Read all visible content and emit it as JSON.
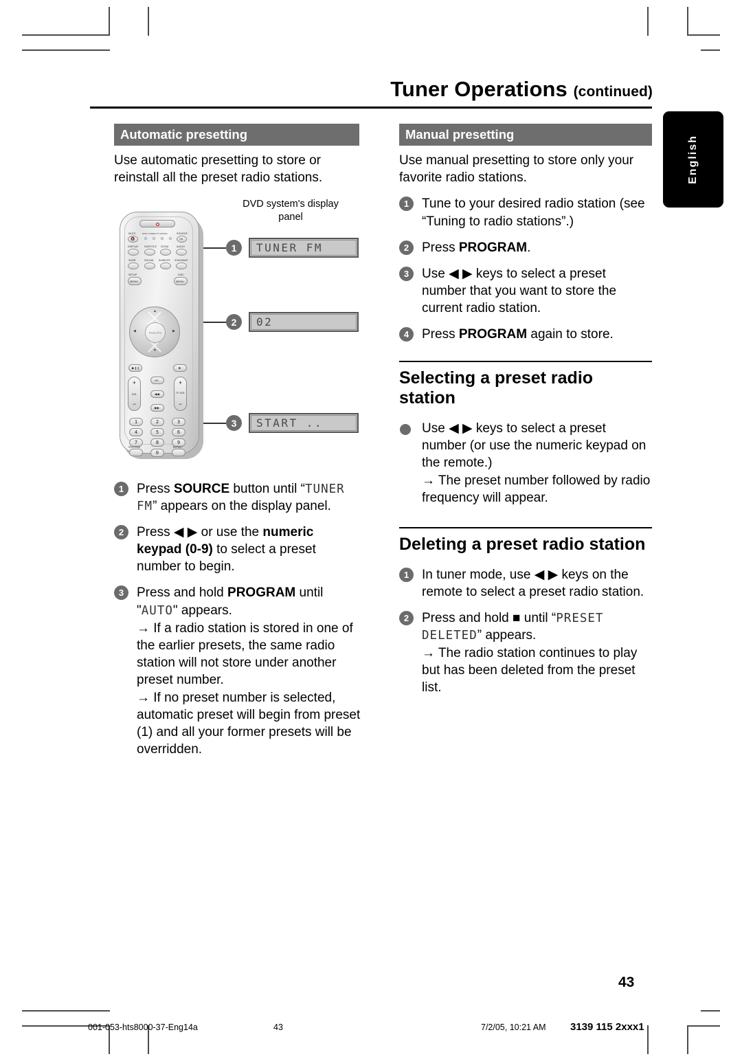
{
  "page": {
    "title": "Tuner Operations",
    "title_suffix": "(continued)",
    "language_tab": "English",
    "page_number": "43"
  },
  "left_column": {
    "section_header": "Automatic presetting",
    "intro": "Use automatic presetting to store or reinstall all the preset radio stations.",
    "illustration": {
      "caption": "DVD system's display panel",
      "remote_brand": "PHILIPS",
      "callouts": [
        {
          "num": "1",
          "display_text": "TUNER FM"
        },
        {
          "num": "2",
          "display_text": "02"
        },
        {
          "num": "3",
          "display_text": "START .."
        }
      ],
      "remote_labels": {
        "mute": "MUTE",
        "source_indicators": "DISC TUNER TV AUX/DI",
        "source": "SOURCE",
        "source_button": "ON",
        "display": "DISPLAY",
        "subtitle": "SUBTITLE",
        "zoom": "ZOOM",
        "audio": "AUDIO",
        "surr": "SURR",
        "sound": "SOUND",
        "surround_off": "SURR/OFF",
        "sonowave": "SONOWAVE",
        "setup": "SETUP",
        "setup_button": "MENU",
        "disc": "DISC",
        "disc_button": "MENU",
        "ok": "OK",
        "vol": "VOL",
        "tv_vol": "TV VOL",
        "program": "PROGRAM",
        "repeat": "REPEAT",
        "keys": [
          "1",
          "2",
          "3",
          "4",
          "5",
          "6",
          "7",
          "8",
          "9",
          "0"
        ]
      }
    },
    "steps": [
      {
        "num": "1",
        "parts": [
          {
            "t": "Press ",
            "s": "n"
          },
          {
            "t": "SOURCE",
            "s": "b"
          },
          {
            "t": " button until “",
            "s": "n"
          },
          {
            "t": "TUNER FM",
            "s": "lcd"
          },
          {
            "t": "” appears on the display panel.",
            "s": "n"
          }
        ]
      },
      {
        "num": "2",
        "parts": [
          {
            "t": "Press ",
            "s": "n"
          },
          {
            "t": "◀ ▶",
            "s": "n"
          },
          {
            "t": " or use the ",
            "s": "n"
          },
          {
            "t": "numeric keypad (0-9)",
            "s": "b"
          },
          {
            "t": " to select a preset number to begin.",
            "s": "n"
          }
        ]
      },
      {
        "num": "3",
        "parts": [
          {
            "t": "Press and hold ",
            "s": "n"
          },
          {
            "t": "PROGRAM",
            "s": "b"
          },
          {
            "t": " until \"",
            "s": "n"
          },
          {
            "t": "AUTO",
            "s": "lcd"
          },
          {
            "t": "\" appears.",
            "s": "n"
          }
        ],
        "notes": [
          "→ If a radio station is stored in one of the earlier presets, the same radio station will not store under another preset number.",
          "→ If no preset number is selected, automatic preset will begin from preset (1) and all your former presets will be overridden."
        ]
      }
    ]
  },
  "right_column": {
    "section_header": "Manual presetting",
    "intro": "Use manual presetting to store only your favorite radio stations.",
    "steps": [
      {
        "num": "1",
        "parts": [
          {
            "t": "Tune to your desired radio station (see “Tuning to radio stations”.)",
            "s": "n"
          }
        ]
      },
      {
        "num": "2",
        "parts": [
          {
            "t": "Press ",
            "s": "n"
          },
          {
            "t": "PROGRAM",
            "s": "b"
          },
          {
            "t": ".",
            "s": "n"
          }
        ]
      },
      {
        "num": "3",
        "parts": [
          {
            "t": "Use ",
            "s": "n"
          },
          {
            "t": "◀ ▶",
            "s": "n"
          },
          {
            "t": " keys to select a preset number that you want to store the current radio station.",
            "s": "n"
          }
        ]
      },
      {
        "num": "4",
        "parts": [
          {
            "t": "Press ",
            "s": "n"
          },
          {
            "t": "PROGRAM",
            "s": "b"
          },
          {
            "t": " again to store.",
            "s": "n"
          }
        ]
      }
    ],
    "subsections": [
      {
        "heading": "Selecting a preset radio station",
        "items": [
          {
            "bullet": true,
            "parts": [
              {
                "t": "Use ",
                "s": "n"
              },
              {
                "t": "◀ ▶",
                "s": "n"
              },
              {
                "t": " keys to select a preset number (or use the numeric keypad on the remote.)",
                "s": "n"
              }
            ],
            "notes": [
              "→ The preset number followed by radio frequency will appear."
            ]
          }
        ]
      },
      {
        "heading": "Deleting a preset radio station",
        "items": [
          {
            "num": "1",
            "parts": [
              {
                "t": "In tuner mode, use ",
                "s": "n"
              },
              {
                "t": "◀ ▶",
                "s": "n"
              },
              {
                "t": " keys on the remote to select a preset radio station.",
                "s": "n"
              }
            ]
          },
          {
            "num": "2",
            "parts": [
              {
                "t": "Press and hold ",
                "s": "n"
              },
              {
                "t": "■",
                "s": "n"
              },
              {
                "t": "  until “",
                "s": "n"
              },
              {
                "t": "PRESET DELETED",
                "s": "lcd"
              },
              {
                "t": "” appears.",
                "s": "n"
              }
            ],
            "notes": [
              "→ The radio station continues to play but has been deleted from the preset list."
            ]
          }
        ]
      }
    ]
  },
  "footer": {
    "file": "001-053-hts8000-37-Eng14a",
    "page": "43",
    "timestamp": "7/2/05, 10:21 AM",
    "doc_number": "3139 115 2xxx1"
  }
}
